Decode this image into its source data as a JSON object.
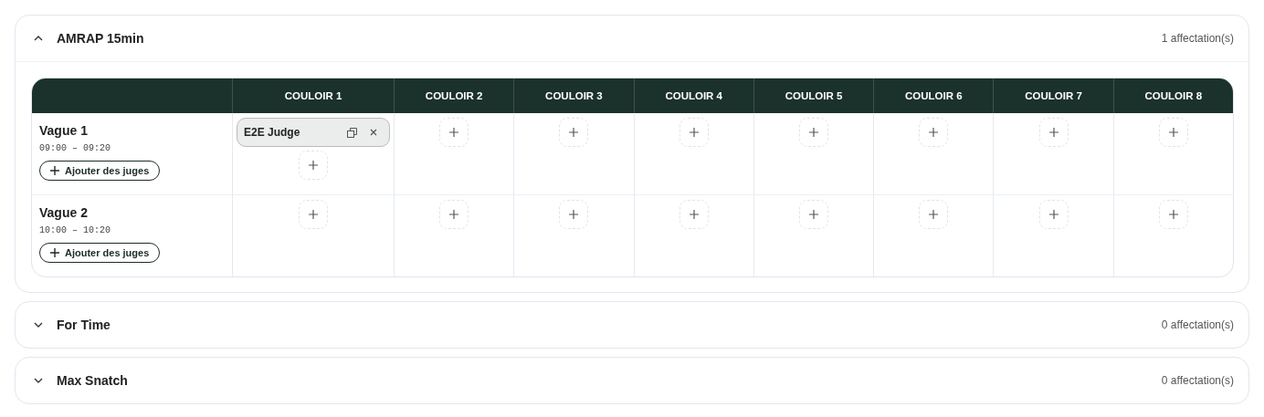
{
  "sections": [
    {
      "title": "AMRAP 15min",
      "expanded": true,
      "count": "1 affectation(s)",
      "table": {
        "columns": [
          "COULOIR 1",
          "COULOIR 2",
          "COULOIR 3",
          "COULOIR 4",
          "COULOIR 5",
          "COULOIR 6",
          "COULOIR 7",
          "COULOIR 8"
        ],
        "rows": [
          {
            "name": "Vague 1",
            "time": "09:00 – 09:20",
            "add_label": "Ajouter des juges",
            "cells": [
              {
                "kind": "assigned",
                "judges": [
                  "E2E Judge"
                ]
              },
              {
                "kind": "empty"
              },
              {
                "kind": "empty"
              },
              {
                "kind": "empty"
              },
              {
                "kind": "empty"
              },
              {
                "kind": "empty"
              },
              {
                "kind": "empty"
              },
              {
                "kind": "empty"
              }
            ]
          },
          {
            "name": "Vague 2",
            "time": "10:00 – 10:20",
            "add_label": "Ajouter des juges",
            "cells": [
              {
                "kind": "empty"
              },
              {
                "kind": "empty"
              },
              {
                "kind": "empty"
              },
              {
                "kind": "empty"
              },
              {
                "kind": "empty"
              },
              {
                "kind": "empty"
              },
              {
                "kind": "empty"
              },
              {
                "kind": "empty"
              }
            ]
          }
        ]
      }
    },
    {
      "title": "For Time",
      "expanded": false,
      "count": "0 affectation(s)"
    },
    {
      "title": "Max Snatch",
      "expanded": false,
      "count": "0 affectation(s)"
    }
  ]
}
